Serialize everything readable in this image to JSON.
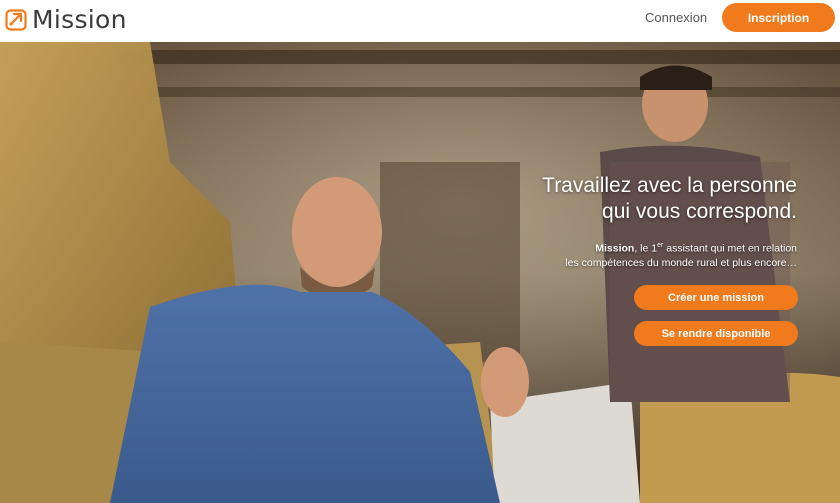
{
  "header": {
    "brand": "Mission",
    "logo_icon": "mission-logo-icon",
    "login_label": "Connexion",
    "signup_label": "Inscription"
  },
  "hero": {
    "title_line1": "Travaillez avec la personne",
    "title_line2": "qui vous correspond.",
    "sub_brand": "Mission",
    "sub_text_a": ", le 1",
    "sub_sup": "er",
    "sub_text_b": " assistant qui met en relation",
    "sub_line2": "les compétences du monde rural et plus encore…",
    "cta_create": "Créer une mission",
    "cta_available": "Se rendre disponible"
  },
  "colors": {
    "accent": "#f07a1c",
    "text_dark": "#3b3b3b",
    "nav_text": "#555555"
  }
}
